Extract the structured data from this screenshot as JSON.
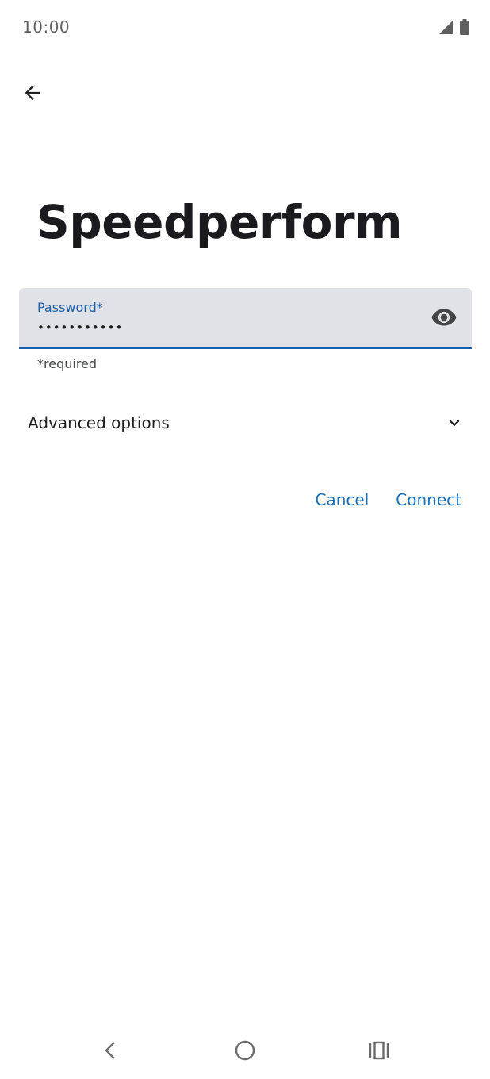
{
  "status_bar": {
    "time": "10:00",
    "icons": [
      "signal-icon",
      "battery-icon"
    ]
  },
  "header": {
    "back_icon": "arrow-left-icon"
  },
  "title": "Speedperform",
  "password_field": {
    "label": "Password*",
    "value": "•••••••••••",
    "toggle_icon": "eye-icon",
    "helper": "*required"
  },
  "advanced": {
    "label": "Advanced options",
    "icon": "chevron-down-icon"
  },
  "actions": {
    "cancel_label": "Cancel",
    "connect_label": "Connect"
  },
  "navigation_bar": {
    "icons": [
      "nav-back-icon",
      "nav-home-icon",
      "nav-recents-icon"
    ]
  },
  "colors": {
    "accent": "#1a5ea8",
    "button_text": "#1a6fb8",
    "field_background": "#e1e2e7"
  }
}
